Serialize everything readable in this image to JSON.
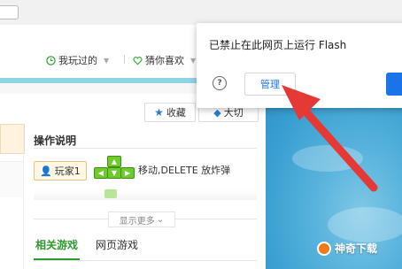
{
  "nav": {
    "played_label": "我玩过的",
    "guess_label": "猜你喜欢",
    "tabs_colors": {
      "green": "#3aa83a"
    }
  },
  "game": {
    "favorite_label": "收藏",
    "share_label": "大切",
    "ops_title": "操作说明",
    "player_label": "玩家1",
    "op_desc": "移动,DELETE 放炸弹",
    "show_more_label": "显示更多",
    "tabs": [
      "相关游戏",
      "网页游戏"
    ]
  },
  "flash_popup": {
    "message": "已禁止在此网页上运行 Flash",
    "manage_label": "管理"
  },
  "watermark": {
    "text": "神奇下载"
  },
  "colors": {
    "arrow": "#e53935",
    "accent_blue": "#1a73e8",
    "sky": "#3aa0d2",
    "tab_active": "#2e9a2e"
  }
}
